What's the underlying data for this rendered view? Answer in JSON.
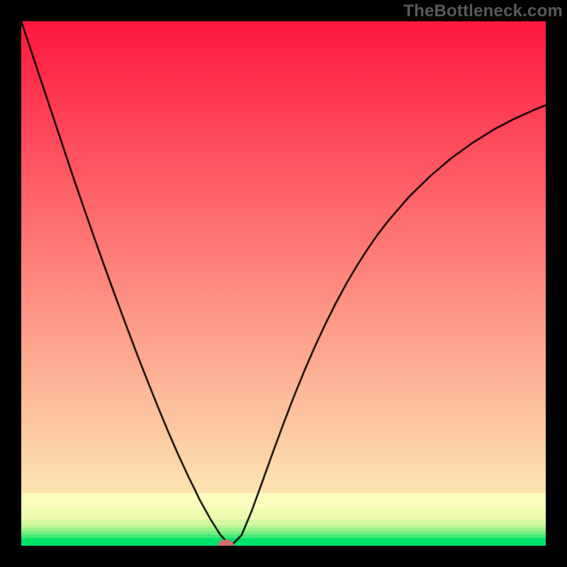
{
  "watermark": {
    "text": "TheBottleneck.com"
  },
  "chart_data": {
    "type": "line",
    "title": "",
    "xlabel": "",
    "ylabel": "",
    "xlim": [
      0,
      100
    ],
    "ylim": [
      0,
      100
    ],
    "grid": false,
    "series": [
      {
        "name": "curve",
        "x": [
          0,
          2,
          4,
          6,
          8,
          10,
          12,
          14,
          16,
          18,
          20,
          22,
          24,
          26,
          28,
          30,
          32,
          33,
          34,
          36,
          38,
          40,
          42,
          44,
          46,
          48,
          50,
          52,
          54,
          56,
          58,
          60,
          62,
          64,
          66,
          68,
          70,
          74,
          78,
          82,
          86,
          90,
          94,
          98,
          100
        ],
        "y": [
          100,
          94,
          88,
          82,
          76,
          70,
          64.2,
          58.5,
          52.9,
          47.4,
          42,
          36.7,
          31.6,
          26.6,
          21.8,
          17.2,
          12.9,
          10.9,
          8.8,
          5.2,
          2,
          0,
          2,
          6.8,
          12.3,
          17.9,
          23.3,
          28.5,
          33.4,
          38,
          42.3,
          46.3,
          50,
          53.4,
          56.5,
          59.4,
          62,
          66.6,
          70.5,
          73.9,
          76.8,
          79.3,
          81.4,
          83.2,
          84
        ]
      }
    ],
    "marker": {
      "x": 39,
      "y": 0,
      "rx": 1.5,
      "ry": 0.9,
      "color": "#d36e6e"
    },
    "bands": [
      {
        "y0": 0,
        "y1": 1.5,
        "color": "#00e36a"
      },
      {
        "y0": 1.5,
        "y1": 2.2,
        "color": "#42e874"
      },
      {
        "y0": 2.2,
        "y1": 2.8,
        "color": "#6fee7e"
      },
      {
        "y0": 2.8,
        "y1": 3.4,
        "color": "#97f28a"
      },
      {
        "y0": 3.4,
        "y1": 4.0,
        "color": "#b8f596"
      },
      {
        "y0": 4.0,
        "y1": 5.0,
        "color": "#d5f8a2"
      },
      {
        "y0": 5.0,
        "y1": 7.0,
        "color": "#eefbb0"
      },
      {
        "y0": 7.0,
        "y1": 10.0,
        "color": "#fcfcbe"
      }
    ],
    "gradient_top": "#ff173f",
    "gradient_bot": "#fcfcbe"
  }
}
